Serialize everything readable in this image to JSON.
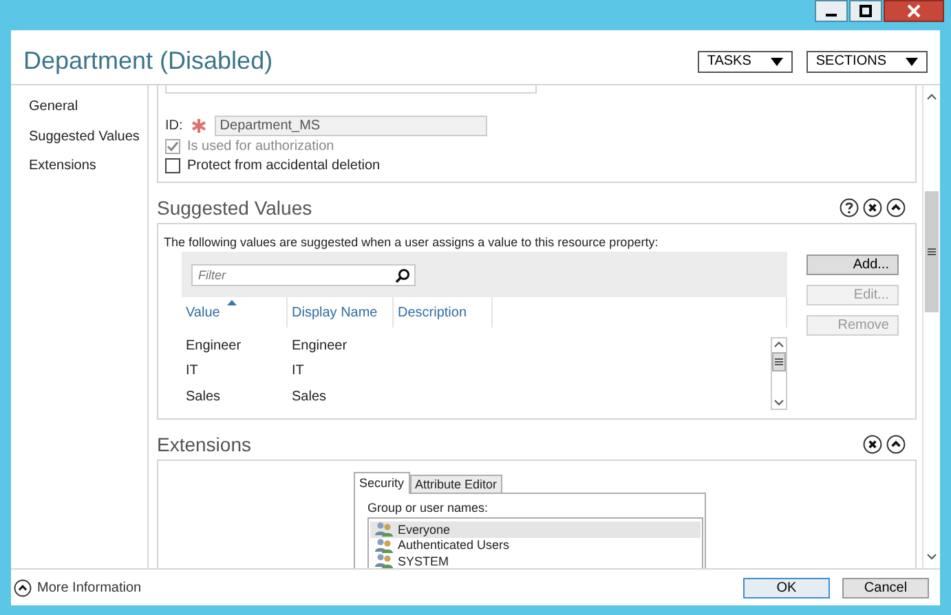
{
  "window": {
    "title": "Department (Disabled)"
  },
  "header_buttons": [
    {
      "label": "TASKS"
    },
    {
      "label": "SECTIONS"
    }
  ],
  "sidebar": {
    "items": [
      {
        "label": "General"
      },
      {
        "label": "Suggested Values"
      },
      {
        "label": "Extensions"
      }
    ]
  },
  "general": {
    "id_label": "ID:",
    "id_value": "Department_MS",
    "checkboxes": [
      {
        "label": "Is used for authorization",
        "checked": true,
        "disabled": true
      },
      {
        "label": "Protect from accidental deletion",
        "checked": false,
        "disabled": false
      }
    ]
  },
  "suggested_values": {
    "title": "Suggested Values",
    "description": "The following values are suggested when a user assigns a value to this resource property:",
    "filter": {
      "placeholder": "Filter"
    },
    "columns": [
      {
        "label": "Value",
        "sorted": true
      },
      {
        "label": "Display Name",
        "sorted": false
      },
      {
        "label": "Description",
        "sorted": false
      }
    ],
    "rows": [
      [
        "Engineer",
        "Engineer"
      ],
      [
        "IT",
        "IT"
      ],
      [
        "Sales",
        "Sales"
      ]
    ],
    "buttons": [
      {
        "label": "Add...",
        "disabled": false
      },
      {
        "label": "Edit...",
        "disabled": true
      },
      {
        "label": "Remove",
        "disabled": true
      }
    ]
  },
  "extensions": {
    "title": "Extensions",
    "tabs": [
      {
        "label": "Security",
        "selected": true
      },
      {
        "label": "Attribute Editor",
        "selected": false
      }
    ],
    "group_label": "Group or user names:",
    "users": [
      {
        "name": "Everyone",
        "selected": true
      },
      {
        "name": "Authenticated Users",
        "selected": false
      },
      {
        "name": "SYSTEM",
        "selected": false
      }
    ]
  },
  "footer": {
    "more_information": "More Information",
    "buttons": [
      {
        "label": "OK"
      },
      {
        "label": "Cancel"
      }
    ]
  }
}
